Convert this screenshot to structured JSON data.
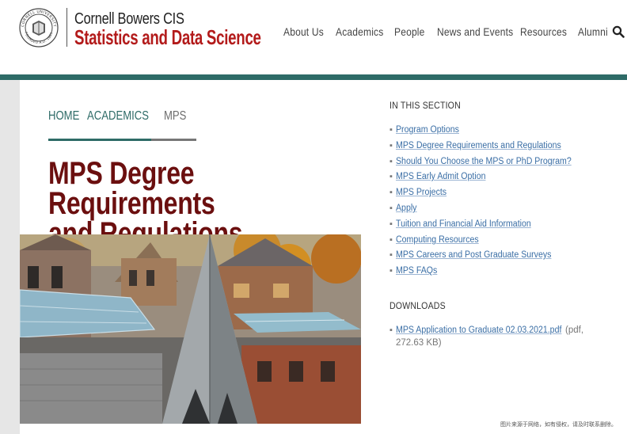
{
  "header": {
    "brand_line1": "Cornell Bowers CIS",
    "brand_line2": "Statistics and Data Science",
    "seal_text_top": "CORNELL UNIVERSITY",
    "seal_text_bottom": "FOUNDED A.D. 1865",
    "nav": [
      {
        "label": "About Us"
      },
      {
        "label": "Academics"
      },
      {
        "label": "People"
      },
      {
        "label": "News and Events"
      },
      {
        "label": "Resources"
      },
      {
        "label": "Alumni"
      }
    ],
    "search_icon": "search-icon"
  },
  "breadcrumb": {
    "home": "HOME",
    "academics": "ACADEMICS",
    "current": "MPS"
  },
  "page": {
    "title_line1": "MPS Degree Requirements",
    "title_line2": "and Regulations"
  },
  "sidebar": {
    "section_heading": "IN THIS SECTION",
    "bullet": "▪",
    "links": [
      {
        "label": "Program Options"
      },
      {
        "label": "MPS Degree Requirements and Regulations"
      },
      {
        "label": "Should You Choose the MPS or PhD Program?"
      },
      {
        "label": "MPS Early Admit Option"
      },
      {
        "label": "MPS Projects"
      },
      {
        "label": "Apply"
      },
      {
        "label": "Tuition and Financial Aid Information"
      },
      {
        "label": "Computing Resources"
      },
      {
        "label": "MPS Careers and Post Graduate Surveys"
      },
      {
        "label": "MPS FAQs"
      }
    ],
    "downloads_heading": "DOWNLOADS",
    "download": {
      "label": "MPS Application to Graduate 02.03.2021.pdf",
      "meta_line1": "(pdf,",
      "meta_line2": "272.63 KB)"
    }
  },
  "watermark": "图片来源于网络，如有侵权，请及时联系删除。",
  "colors": {
    "teal": "#2e6b67",
    "brand_red": "#b31b1b",
    "title_maroon": "#6b0f0f",
    "link_blue": "#3a6ea5"
  }
}
